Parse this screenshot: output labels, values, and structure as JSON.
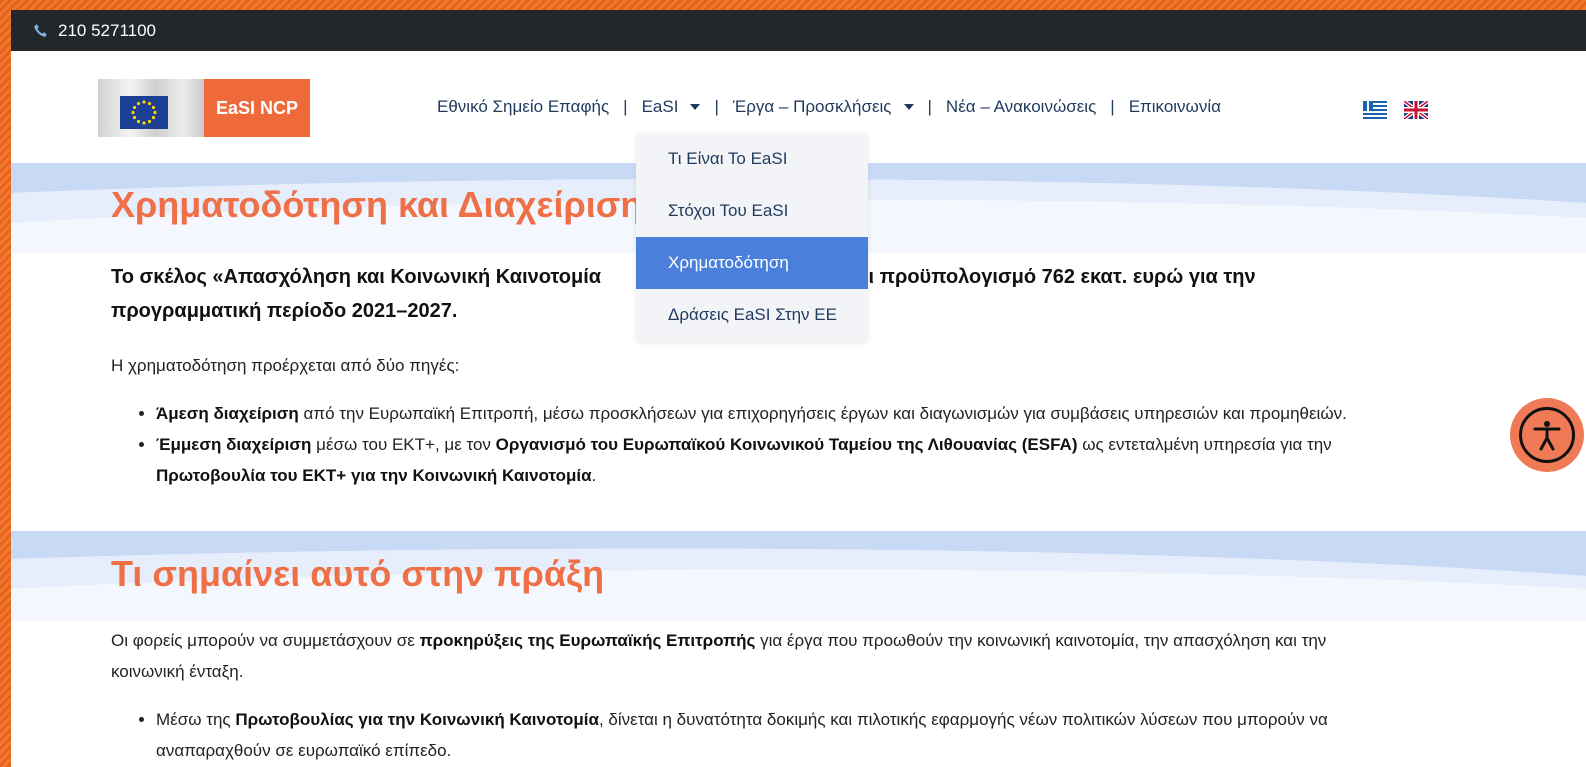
{
  "topbar": {
    "phone": "210 5271100",
    "phone_icon": "phone-icon"
  },
  "logo": {
    "text": "EaSI NCP"
  },
  "nav": {
    "items": [
      {
        "label": "Εθνικό Σημείο Επαφής",
        "has_caret": false
      },
      {
        "label": "EaSI",
        "has_caret": true
      },
      {
        "label": "Έργα – Προσκλήσεις",
        "has_caret": true
      },
      {
        "label": "Νέα – Ανακοινώσεις",
        "has_caret": false
      },
      {
        "label": "Επικοινωνία",
        "has_caret": false
      }
    ],
    "separator": "|"
  },
  "dropdown": {
    "items": [
      {
        "label": "Τι Είναι Το EaSI",
        "active": false
      },
      {
        "label": "Στόχοι Του EaSI",
        "active": false
      },
      {
        "label": "Χρηματοδότηση",
        "active": true
      },
      {
        "label": "Δράσεις EaSI Στην ΕΕ",
        "active": false
      }
    ]
  },
  "section1": {
    "title": "Χρηματοδότηση και Διαχείριση",
    "lead_a": "Το σκέλος «Απασχόληση και Κοινωνική Καινοτομία",
    "lead_b": "έτει προϋπολογισμό 762 εκατ. ευρώ για την",
    "lead_c": "προγραμματική περίοδο 2021–2027.",
    "intro": "Η χρηματοδότηση προέρχεται από δύο πηγές:",
    "bullets": [
      {
        "bold": "Άμεση διαχείριση",
        "text": " από την Ευρωπαϊκή Επιτροπή, μέσω προσκλήσεων για επιχορηγήσεις έργων και διαγωνισμών για συμβάσεις υπηρεσιών και προμηθειών."
      },
      {
        "bold": "Έμμεση διαχείριση",
        "text1": " μέσω του ΕΚΤ+, με τον ",
        "bold2": "Οργανισμό του Ευρωπαϊκού Κοινωνικού Ταμείου της Λιθουανίας (ESFA)",
        "text2": " ως εντεταλμένη υπηρεσία για την ",
        "bold3": "Πρωτοβουλία του ΕΚΤ+ για την Κοινωνική Καινοτομία",
        "text3": "."
      }
    ]
  },
  "section2": {
    "title": "Τι σημαίνει αυτό στην πράξη",
    "intro_a": "Οι φορείς μπορούν να συμμετάσχουν σε ",
    "intro_bold": "προκηρύξεις της Ευρωπαϊκής Επιτροπής",
    "intro_b": " για έργα που προωθούν την κοινωνική καινοτομία, την απασχόληση και την κοινωνική ένταξη.",
    "bullet_a": "Μέσω της ",
    "bullet_bold": "Πρωτοβουλίας για την Κοινωνική Καινοτομία",
    "bullet_b": ", δίνεται η δυνατότητα δοκιμής και πιλοτικής εφαρμογής νέων πολιτικών λύσεων που μπορούν να αναπαραχθούν σε ευρωπαϊκό επίπεδο."
  },
  "colors": {
    "accent": "#ef6f47",
    "nav": "#1f3a5f",
    "dropdown_active": "#4a7fdc",
    "topbar": "#23272b"
  }
}
